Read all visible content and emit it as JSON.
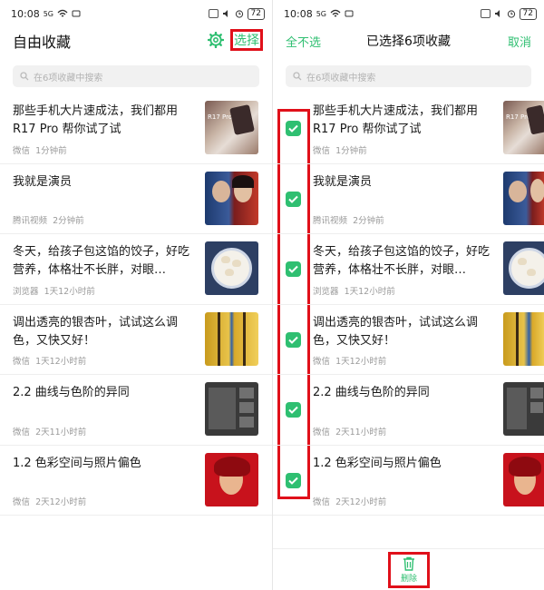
{
  "status": {
    "time": "10:08",
    "network": "5G",
    "battery": "72"
  },
  "left_screen": {
    "title": "自由收藏",
    "select_label": "选择",
    "search_placeholder": "在6项收藏中搜索",
    "items": [
      {
        "title": "那些手机大片速成法，我们都用R17 Pro 帮你试了试",
        "source": "微信",
        "time": "1分钟前",
        "thumb": "phone-photography-thumbnail"
      },
      {
        "title": "我就是演员",
        "source": "腾讯视频",
        "time": "2分钟前",
        "thumb": "actors-thumbnail"
      },
      {
        "title": "冬天，给孩子包这馅的饺子，好吃营养，体格壮不长胖，对眼…",
        "source": "浏览器",
        "time": "1天12小时前",
        "thumb": "dumplings-thumbnail"
      },
      {
        "title": "调出透亮的银杏叶，试试这么调色，又快又好！",
        "source": "微信",
        "time": "1天12小时前",
        "thumb": "ginkgo-thumbnail"
      },
      {
        "title": "2.2 曲线与色阶的异同",
        "source": "微信",
        "time": "2天11小时前",
        "thumb": "photoshop-thumbnail"
      },
      {
        "title": "1.2  色彩空间与照片偏色",
        "source": "微信",
        "time": "2天12小时前",
        "thumb": "red-portrait-thumbnail"
      }
    ]
  },
  "right_screen": {
    "deselect_all_label": "全不选",
    "selection_title": "已选择6项收藏",
    "cancel_label": "取消",
    "search_placeholder": "在6项收藏中搜索",
    "delete_label": "删除",
    "items": [
      {
        "title": "那些手机大片速成法，我们都用R17 Pro 帮你试了试",
        "source": "微信",
        "time": "1分钟前",
        "checked": true
      },
      {
        "title": "我就是演员",
        "source": "腾讯视频",
        "time": "2分钟前",
        "checked": true
      },
      {
        "title": "冬天，给孩子包这馅的饺子，好吃营养，体格壮不长胖，对眼…",
        "source": "浏览器",
        "time": "1天12小时前",
        "checked": true
      },
      {
        "title": "调出透亮的银杏叶，试试这么调色，又快又好！",
        "source": "微信",
        "time": "1天12小时前",
        "checked": true
      },
      {
        "title": "2.2 曲线与色阶的异同",
        "source": "微信",
        "time": "2天11小时前",
        "checked": true
      },
      {
        "title": "1.2  色彩空间与照片偏色",
        "source": "微信",
        "time": "2天12小时前",
        "checked": true
      }
    ]
  },
  "colors": {
    "accent": "#2fbf71",
    "highlight": "#e0101a",
    "meta_text": "#9a9a9a"
  },
  "thumb_text": "R17 Pro"
}
